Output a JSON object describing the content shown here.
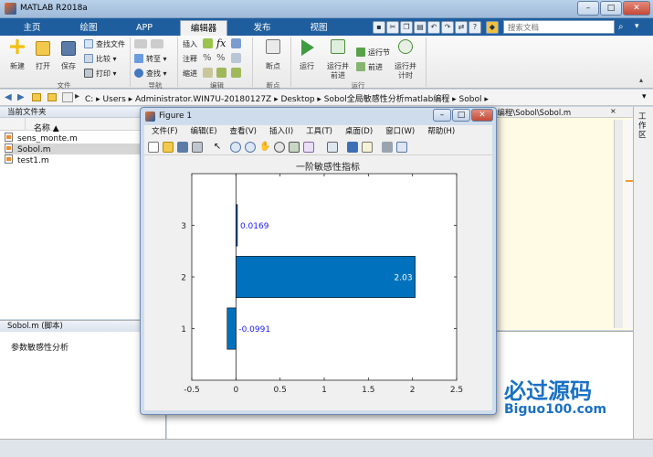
{
  "app": {
    "title": "MATLAB R2018a"
  },
  "tabs": [
    {
      "label": "主页"
    },
    {
      "label": "绘图"
    },
    {
      "label": "APP"
    },
    {
      "label": "编辑器"
    },
    {
      "label": "发布"
    },
    {
      "label": "视图"
    }
  ],
  "search": {
    "placeholder": "搜索文档"
  },
  "ribbon": {
    "new": "新建",
    "open": "打开",
    "save": "保存",
    "find_files": "查找文件",
    "compare": "比较",
    "print": "打印",
    "insert": "插入",
    "comment": "注释",
    "indent": "缩进",
    "goto": "转至",
    "find": "查找",
    "breakpoint": "断点",
    "run": "运行",
    "run_advance_1": "运行并",
    "run_advance_2": "前进",
    "run_section": "运行节",
    "advance": "前进",
    "run_time_1": "运行并",
    "run_time_2": "计时",
    "group_file": "文件",
    "group_nav": "导航",
    "group_edit": "编辑",
    "group_bp": "断点",
    "group_run": "运行"
  },
  "address": {
    "parts": [
      "C:",
      "Users",
      "Administrator.WIN7U-20180127Z",
      "Desktop",
      "Sobol全局敏感性分析matlab编程",
      "Sobol"
    ],
    "path_text": "C: ▸ Users ▸ Administrator.WIN7U-20180127Z ▸ Desktop ▸ Sobol全局敏感性分析matlab编程 ▸ Sobol ▸"
  },
  "current_folder": {
    "title": "当前文件夹",
    "column_name": "名称 ▲",
    "files": [
      {
        "name": "sens_monte.m"
      },
      {
        "name": "Sobol.m"
      },
      {
        "name": "test1.m"
      }
    ]
  },
  "details": {
    "title": "Sobol.m  (脚本)",
    "description": "参数敏感性分析"
  },
  "editor": {
    "tab_path": "b编程\\Sobol\\Sobol.m"
  },
  "workspace": {
    "label": "工作区"
  },
  "figure": {
    "title": "Figure 1",
    "menu": [
      "文件(F)",
      "编辑(E)",
      "查看(V)",
      "插入(I)",
      "工具(T)",
      "桌面(D)",
      "窗口(W)",
      "帮助(H)"
    ]
  },
  "watermark": {
    "brand": "必过源码",
    "url": "Biguo100.com"
  },
  "colors": {
    "bar": "#0072BD",
    "label_blue": "#1a1aff",
    "tab_strip": "#1f5e9e"
  },
  "chart_data": {
    "type": "bar",
    "orientation": "horizontal",
    "title": "一阶敏感性指标",
    "categories": [
      "1",
      "2",
      "3"
    ],
    "values": [
      -0.0991,
      2.03,
      0.0169
    ],
    "data_labels": [
      "-0.0991",
      "2.03",
      "0.0169"
    ],
    "xlim": [
      -0.5,
      2.5
    ],
    "xticks": [
      "-0.5",
      "0",
      "0.5",
      "1",
      "1.5",
      "2",
      "2.5"
    ],
    "yticks": [
      "1",
      "2",
      "3"
    ],
    "grid": false
  }
}
